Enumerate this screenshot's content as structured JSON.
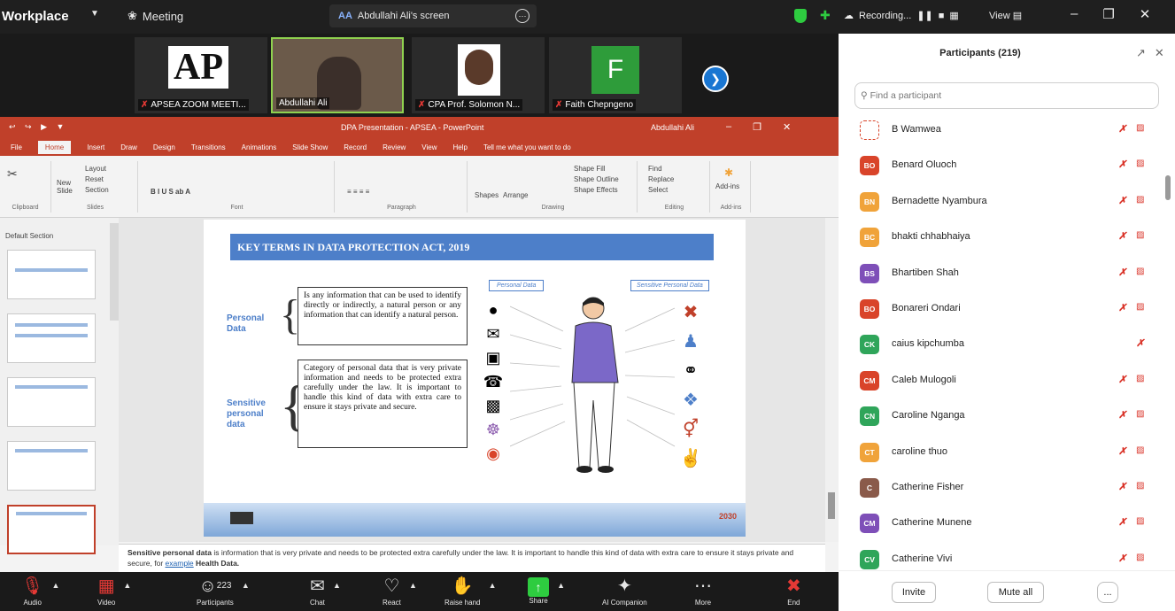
{
  "topbar": {
    "app_title": "Workplace",
    "meeting_label": "Meeting",
    "screen_label": "Abdullahi Ali's screen",
    "screen_prefix": "AA",
    "recording_label": "Recording...",
    "view_label": "View"
  },
  "videos": [
    {
      "name": "APSEA ZOOM MEETI...",
      "logo": "AP"
    },
    {
      "name": "Abdullahi Ali"
    },
    {
      "name": "CPA Prof. Solomon N..."
    },
    {
      "name": "Faith Chepngeno",
      "initial": "F"
    }
  ],
  "ppt": {
    "title": "DPA Presentation - APSEA - PowerPoint",
    "user": "Abdullahi Ali",
    "tabs": [
      "File",
      "Home",
      "Insert",
      "Draw",
      "Design",
      "Transitions",
      "Animations",
      "Slide Show",
      "Record",
      "Review",
      "View",
      "Help",
      "Tell me what you want to do"
    ],
    "ribbon": {
      "clipboard": "Clipboard",
      "slides": "Slides",
      "font": "Font",
      "paragraph": "Paragraph",
      "drawing": "Drawing",
      "editing": "Editing",
      "addins": "Add-ins",
      "layout": "Layout",
      "reset": "Reset",
      "section": "Section",
      "new_slide": "New Slide",
      "find": "Find",
      "replace": "Replace",
      "select": "Select",
      "shapes": "Shapes",
      "arrange": "Arrange",
      "shape_fill": "Shape Fill",
      "shape_outline": "Shape Outline",
      "shape_effects": "Shape Effects"
    },
    "section_label": "Default Section",
    "slide": {
      "heading": "KEY TERMS IN DATA PROTECTION ACT, 2019",
      "term1": "Personal Data",
      "def1": "Is any information that can be used to identify directly or indirectly, a natural person or any information that can identify a natural person.",
      "term2": "Sensitive personal data",
      "def2": "Category of personal data that is very private information and needs to be protected extra carefully under the law. It is important to handle this kind of data with extra care to ensure it stays private and secure.",
      "tag_personal": "Personal Data",
      "tag_sensitive": "Sensitive Personal Data",
      "footer_year": "2030"
    },
    "notes_bold": "Sensitive personal data",
    "notes_text": " is information that is very private and needs to be protected extra carefully under the law. It is important to handle this kind of data with extra care to ensure it stays private and secure, for ",
    "notes_link": "example",
    "notes_end": " Health Data."
  },
  "participants": {
    "title": "Participants (219)",
    "search_placeholder": "Find a participant",
    "list": [
      {
        "initials": "",
        "name": "B Wamwea",
        "color": "#ffffff",
        "video_off": true
      },
      {
        "initials": "BO",
        "name": "Benard Oluoch",
        "color": "#d9442a",
        "video_off": true
      },
      {
        "initials": "BN",
        "name": "Bernadette Nyambura",
        "color": "#f0a33a",
        "video_off": true
      },
      {
        "initials": "BC",
        "name": "bhakti chhabhaiya",
        "color": "#f0a33a",
        "video_off": true
      },
      {
        "initials": "BS",
        "name": "Bhartiben Shah",
        "color": "#7e4fb8",
        "video_off": true
      },
      {
        "initials": "BO",
        "name": "Bonareri Ondari",
        "color": "#d9442a",
        "video_off": true
      },
      {
        "initials": "CK",
        "name": "caius kipchumba",
        "color": "#2fa55a",
        "video_off": false
      },
      {
        "initials": "CM",
        "name": "Caleb Mulogoli",
        "color": "#d9442a",
        "video_off": true
      },
      {
        "initials": "CN",
        "name": "Caroline Nganga",
        "color": "#2fa55a",
        "video_off": true
      },
      {
        "initials": "CT",
        "name": "caroline thuo",
        "color": "#f0a33a",
        "video_off": true
      },
      {
        "initials": "C",
        "name": "Catherine Fisher",
        "color": "#8a5a4a",
        "video_off": true
      },
      {
        "initials": "CM",
        "name": "Catherine Munene",
        "color": "#7e4fb8",
        "video_off": true
      },
      {
        "initials": "CV",
        "name": "Catherine Vivi",
        "color": "#2fa55a",
        "video_off": true
      }
    ],
    "invite_label": "Invite",
    "mute_all_label": "Mute all",
    "more_label": "..."
  },
  "toolbar": {
    "participants_count": "223",
    "items": [
      "Audio",
      "Video",
      "Participants",
      "Chat",
      "React",
      "Raise hand",
      "Share",
      "AI Companion",
      "More",
      "End"
    ]
  }
}
